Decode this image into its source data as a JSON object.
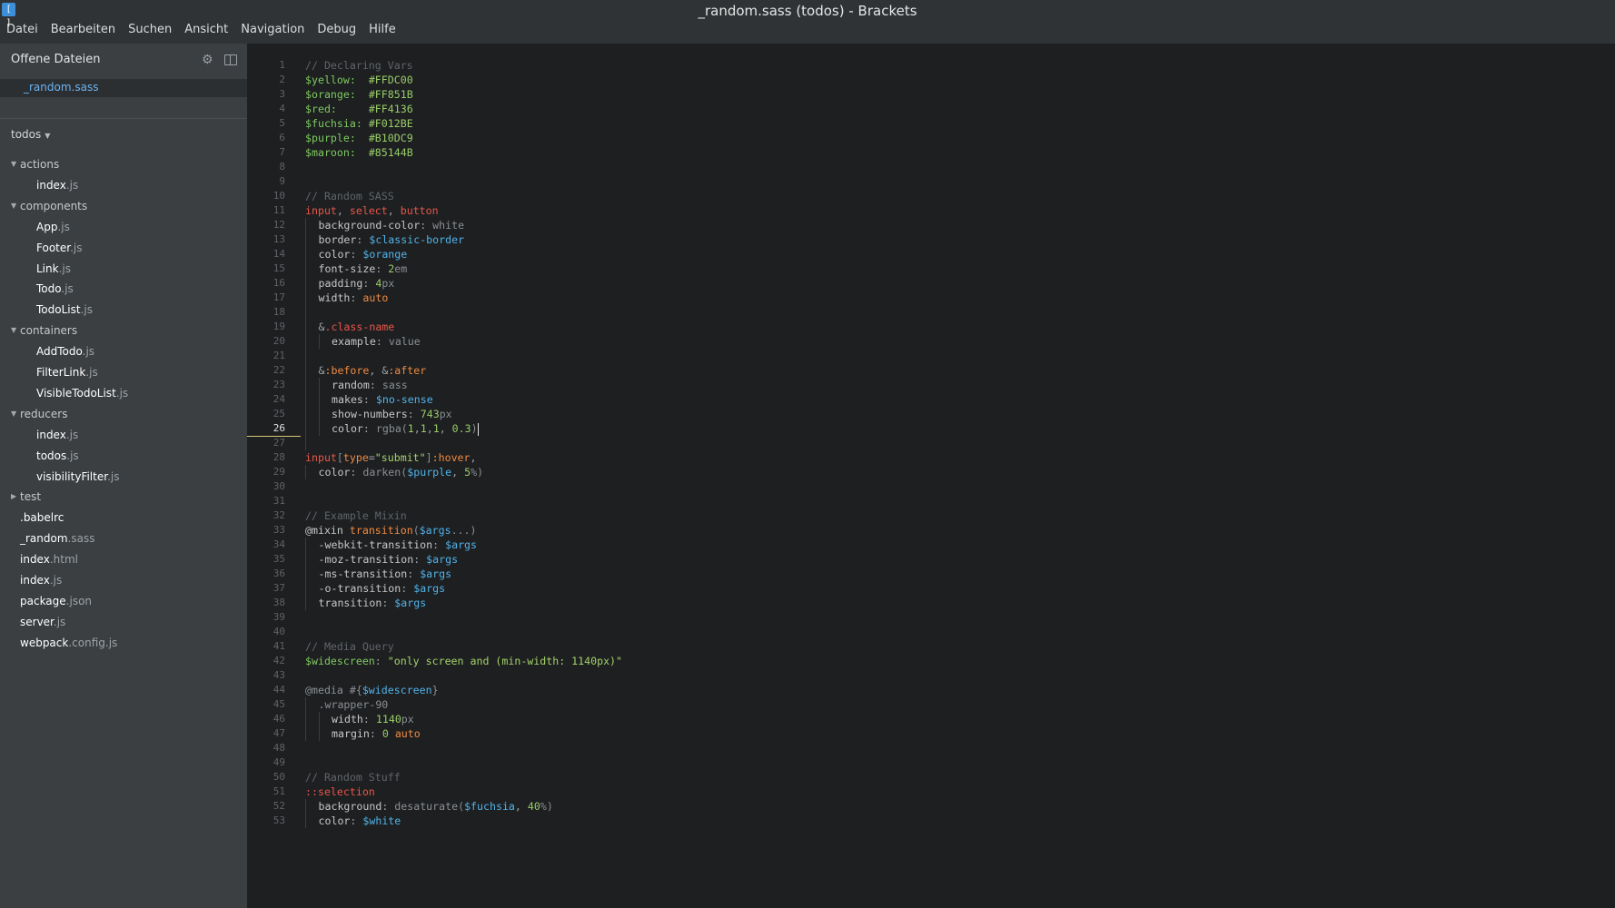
{
  "window": {
    "title": "_random.sass (todos) - Brackets",
    "app_icon": "brackets-logo-icon"
  },
  "menu": [
    "Datei",
    "Bearbeiten",
    "Suchen",
    "Ansicht",
    "Navigation",
    "Debug",
    "Hilfe"
  ],
  "sidebar": {
    "open_files_title": "Offene Dateien",
    "open_files": [
      {
        "name": "_random",
        "ext": ".sass"
      }
    ],
    "project": "todos",
    "tree": [
      {
        "type": "folder",
        "label": "actions",
        "depth": 0,
        "open": true
      },
      {
        "type": "file",
        "name": "index",
        "ext": ".js",
        "depth": 1
      },
      {
        "type": "folder",
        "label": "components",
        "depth": 0,
        "open": true
      },
      {
        "type": "file",
        "name": "App",
        "ext": ".js",
        "depth": 1
      },
      {
        "type": "file",
        "name": "Footer",
        "ext": ".js",
        "depth": 1
      },
      {
        "type": "file",
        "name": "Link",
        "ext": ".js",
        "depth": 1
      },
      {
        "type": "file",
        "name": "Todo",
        "ext": ".js",
        "depth": 1
      },
      {
        "type": "file",
        "name": "TodoList",
        "ext": ".js",
        "depth": 1
      },
      {
        "type": "folder",
        "label": "containers",
        "depth": 0,
        "open": true
      },
      {
        "type": "file",
        "name": "AddTodo",
        "ext": ".js",
        "depth": 1
      },
      {
        "type": "file",
        "name": "FilterLink",
        "ext": ".js",
        "depth": 1
      },
      {
        "type": "file",
        "name": "VisibleTodoList",
        "ext": ".js",
        "depth": 1
      },
      {
        "type": "folder",
        "label": "reducers",
        "depth": 0,
        "open": true
      },
      {
        "type": "file",
        "name": "index",
        "ext": ".js",
        "depth": 1
      },
      {
        "type": "file",
        "name": "todos",
        "ext": ".js",
        "depth": 1
      },
      {
        "type": "file",
        "name": "visibilityFilter",
        "ext": ".js",
        "depth": 1
      },
      {
        "type": "folder",
        "label": "test",
        "depth": 0,
        "open": false
      },
      {
        "type": "file",
        "name": ".babelrc",
        "ext": "",
        "depth": 0
      },
      {
        "type": "file",
        "name": "_random",
        "ext": ".sass",
        "depth": 0
      },
      {
        "type": "file",
        "name": "index",
        "ext": ".html",
        "depth": 0
      },
      {
        "type": "file",
        "name": "index",
        "ext": ".js",
        "depth": 0
      },
      {
        "type": "file",
        "name": "package",
        "ext": ".json",
        "depth": 0
      },
      {
        "type": "file",
        "name": "server",
        "ext": ".js",
        "depth": 0
      },
      {
        "type": "file",
        "name": "webpack",
        "ext": ".config.js",
        "depth": 0
      }
    ]
  },
  "editor": {
    "active_line": 26,
    "lines": [
      [
        [
          "c",
          "// Declaring Vars"
        ]
      ],
      [
        [
          "d",
          "$yellow:"
        ],
        [
          "p",
          "  "
        ],
        [
          "v",
          "#FFDC00"
        ]
      ],
      [
        [
          "d",
          "$orange:"
        ],
        [
          "p",
          "  "
        ],
        [
          "v",
          "#FF851B"
        ]
      ],
      [
        [
          "d",
          "$red:"
        ],
        [
          "p",
          "     "
        ],
        [
          "v",
          "#FF4136"
        ]
      ],
      [
        [
          "d",
          "$fuchsia:"
        ],
        [
          "p",
          " "
        ],
        [
          "v",
          "#F012BE"
        ]
      ],
      [
        [
          "d",
          "$purple:"
        ],
        [
          "p",
          "  "
        ],
        [
          "v",
          "#B10DC9"
        ]
      ],
      [
        [
          "d",
          "$maroon:"
        ],
        [
          "p",
          "  "
        ],
        [
          "v",
          "#85144B"
        ]
      ],
      [],
      [],
      [
        [
          "c",
          "// Random SASS"
        ]
      ],
      [
        [
          "s",
          "input"
        ],
        [
          "p",
          ", "
        ],
        [
          "s",
          "select"
        ],
        [
          "p",
          ", "
        ],
        [
          "s",
          "button"
        ]
      ],
      [
        [
          "i",
          1
        ],
        [
          "t",
          "background-color"
        ],
        [
          "p",
          ": "
        ],
        [
          "w",
          "white"
        ]
      ],
      [
        [
          "i",
          1
        ],
        [
          "t",
          "border"
        ],
        [
          "p",
          ": "
        ],
        [
          "r",
          "$classic-border"
        ]
      ],
      [
        [
          "i",
          1
        ],
        [
          "t",
          "color"
        ],
        [
          "p",
          ": "
        ],
        [
          "r",
          "$orange"
        ]
      ],
      [
        [
          "i",
          1
        ],
        [
          "t",
          "font-size"
        ],
        [
          "p",
          ": "
        ],
        [
          "n",
          "2"
        ],
        [
          "u",
          "em"
        ]
      ],
      [
        [
          "i",
          1
        ],
        [
          "t",
          "padding"
        ],
        [
          "p",
          ": "
        ],
        [
          "n",
          "4"
        ],
        [
          "u",
          "px"
        ]
      ],
      [
        [
          "i",
          1
        ],
        [
          "t",
          "width"
        ],
        [
          "p",
          ": "
        ],
        [
          "k",
          "auto"
        ]
      ],
      [
        [
          "i",
          1
        ]
      ],
      [
        [
          "i",
          1
        ],
        [
          "p",
          "&"
        ],
        [
          "s",
          ".class-name"
        ]
      ],
      [
        [
          "i",
          2
        ],
        [
          "t",
          "example"
        ],
        [
          "p",
          ": "
        ],
        [
          "w",
          "value"
        ]
      ],
      [
        [
          "i",
          1
        ]
      ],
      [
        [
          "i",
          1
        ],
        [
          "p",
          "&"
        ],
        [
          "k",
          ":before"
        ],
        [
          "p",
          ", &"
        ],
        [
          "k",
          ":after"
        ]
      ],
      [
        [
          "i",
          2
        ],
        [
          "t",
          "random"
        ],
        [
          "p",
          ": "
        ],
        [
          "w",
          "sass"
        ]
      ],
      [
        [
          "i",
          2
        ],
        [
          "t",
          "makes"
        ],
        [
          "p",
          ": "
        ],
        [
          "r",
          "$no-sense"
        ]
      ],
      [
        [
          "i",
          2
        ],
        [
          "t",
          "show-numbers"
        ],
        [
          "p",
          ": "
        ],
        [
          "n",
          "743"
        ],
        [
          "u",
          "px"
        ]
      ],
      [
        [
          "i",
          2
        ],
        [
          "t",
          "color"
        ],
        [
          "p",
          ": "
        ],
        [
          "w",
          "rgba("
        ],
        [
          "n",
          "1"
        ],
        [
          "p",
          ","
        ],
        [
          "n",
          "1"
        ],
        [
          "p",
          ","
        ],
        [
          "n",
          "1"
        ],
        [
          "p",
          ", "
        ],
        [
          "n",
          "0.3"
        ],
        [
          "w",
          ")"
        ],
        [
          "x",
          ""
        ]
      ],
      [
        [
          "i",
          1
        ]
      ],
      [
        [
          "s",
          "input"
        ],
        [
          "w",
          "["
        ],
        [
          "k",
          "type"
        ],
        [
          "p",
          "="
        ],
        [
          "g",
          "\"submit\""
        ],
        [
          "w",
          "]"
        ],
        [
          "k",
          ":hover"
        ],
        [
          "p",
          ","
        ]
      ],
      [
        [
          "i",
          1
        ],
        [
          "t",
          "color"
        ],
        [
          "p",
          ": "
        ],
        [
          "w",
          "darken("
        ],
        [
          "r",
          "$purple"
        ],
        [
          "p",
          ", "
        ],
        [
          "n",
          "5"
        ],
        [
          "u",
          "%"
        ],
        [
          "w",
          ")"
        ]
      ],
      [],
      [],
      [
        [
          "c",
          "// Example Mixin"
        ]
      ],
      [
        [
          "t",
          "@mixin "
        ],
        [
          "k",
          "transition"
        ],
        [
          "w",
          "("
        ],
        [
          "r",
          "$args"
        ],
        [
          "w",
          "...)"
        ]
      ],
      [
        [
          "i",
          1
        ],
        [
          "t",
          "-webkit-transition"
        ],
        [
          "p",
          ": "
        ],
        [
          "r",
          "$args"
        ]
      ],
      [
        [
          "i",
          1
        ],
        [
          "t",
          "-moz-transition"
        ],
        [
          "p",
          ": "
        ],
        [
          "r",
          "$args"
        ]
      ],
      [
        [
          "i",
          1
        ],
        [
          "t",
          "-ms-transition"
        ],
        [
          "p",
          ": "
        ],
        [
          "r",
          "$args"
        ]
      ],
      [
        [
          "i",
          1
        ],
        [
          "t",
          "-o-transition"
        ],
        [
          "p",
          ": "
        ],
        [
          "r",
          "$args"
        ]
      ],
      [
        [
          "i",
          1
        ],
        [
          "t",
          "transition"
        ],
        [
          "p",
          ": "
        ],
        [
          "r",
          "$args"
        ]
      ],
      [],
      [],
      [
        [
          "c",
          "// Media Query"
        ]
      ],
      [
        [
          "d",
          "$widescreen"
        ],
        [
          "p",
          ": "
        ],
        [
          "g",
          "\"only screen and (min-width: 1140px)\""
        ]
      ],
      [],
      [
        [
          "w",
          "@media #{"
        ],
        [
          "r",
          "$widescreen"
        ],
        [
          "w",
          "}"
        ]
      ],
      [
        [
          "i",
          1
        ],
        [
          "w",
          ".wrapper-90"
        ]
      ],
      [
        [
          "i",
          2
        ],
        [
          "t",
          "width"
        ],
        [
          "p",
          ": "
        ],
        [
          "n",
          "1140"
        ],
        [
          "u",
          "px"
        ]
      ],
      [
        [
          "i",
          2
        ],
        [
          "t",
          "margin"
        ],
        [
          "p",
          ": "
        ],
        [
          "n",
          "0"
        ],
        [
          "p",
          " "
        ],
        [
          "k",
          "auto"
        ]
      ],
      [],
      [],
      [
        [
          "c",
          "// Random Stuff"
        ]
      ],
      [
        [
          "s",
          "::selection"
        ]
      ],
      [
        [
          "i",
          1
        ],
        [
          "t",
          "background"
        ],
        [
          "p",
          ": "
        ],
        [
          "w",
          "desaturate("
        ],
        [
          "r",
          "$fuchsia"
        ],
        [
          "p",
          ", "
        ],
        [
          "n",
          "40"
        ],
        [
          "u",
          "%"
        ],
        [
          "w",
          ")"
        ]
      ],
      [
        [
          "i",
          1
        ],
        [
          "t",
          "color"
        ],
        [
          "p",
          ": "
        ],
        [
          "r",
          "$white"
        ]
      ]
    ]
  },
  "colors": {
    "sidebar_bg": "#3b3f42",
    "editor_bg": "#1d1f21",
    "titlebar_bg": "#2f3336",
    "accent": "#6ab4f2"
  }
}
